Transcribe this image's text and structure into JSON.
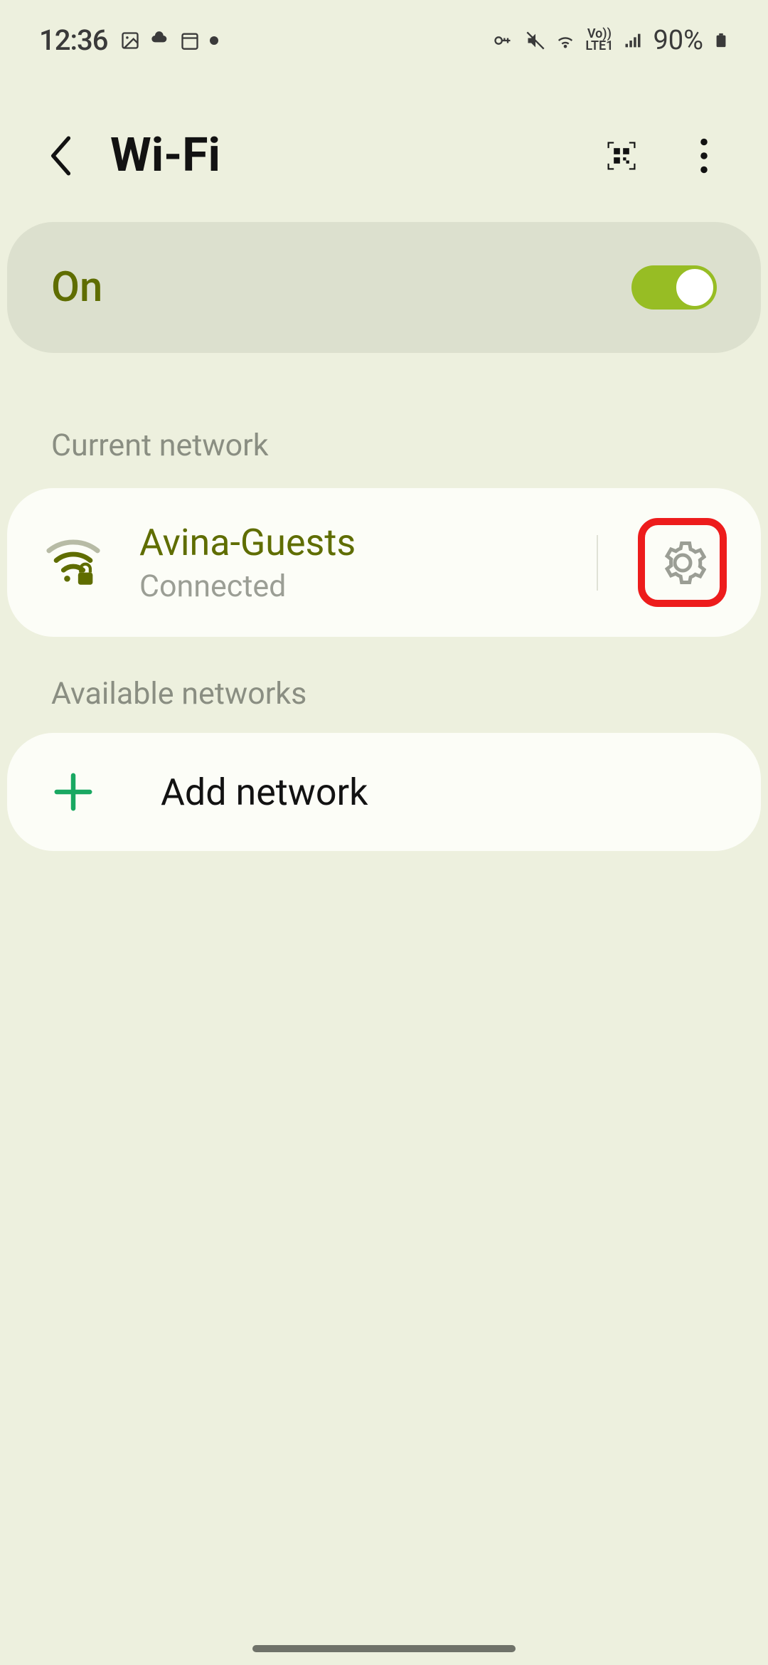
{
  "status_bar": {
    "time": "12:36",
    "battery": "90%",
    "lte_label": "LTE1",
    "vo_label": "Vo))"
  },
  "header": {
    "title": "Wi-Fi"
  },
  "toggle": {
    "label": "On"
  },
  "sections": {
    "current": "Current network",
    "available": "Available networks"
  },
  "current_network": {
    "name": "Avina-Guests",
    "status": "Connected"
  },
  "add": {
    "label": "Add network"
  },
  "colors": {
    "accent": "#5f6d00",
    "switch_on": "#97bd24",
    "highlight": "#ed1c1c",
    "plus": "#19a862"
  }
}
